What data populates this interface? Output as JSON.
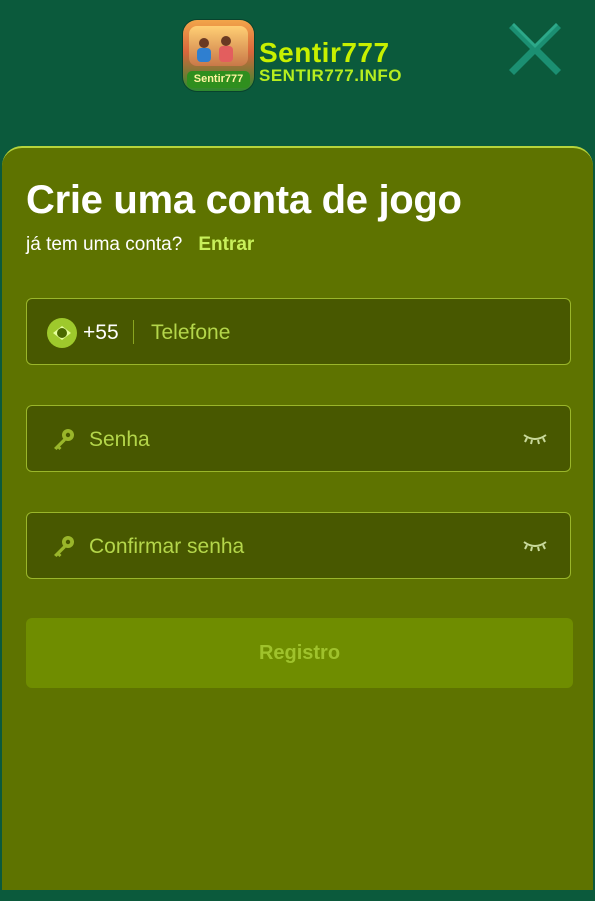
{
  "header": {
    "brand_name": "Sentir777",
    "brand_url": "SENTIR777.INFO",
    "logo_tag": "Sentir777",
    "close_icon": "close-x-icon"
  },
  "form": {
    "title": "Crie uma conta de jogo",
    "subtitle": "já tem uma conta?",
    "login_link": "Entrar",
    "phone": {
      "country_code": "+55",
      "placeholder": "Telefone",
      "flag_icon": "brazil-flag-icon"
    },
    "password": {
      "placeholder": "Senha",
      "key_icon": "key-icon",
      "toggle_icon": "eye-closed-icon"
    },
    "confirm_password": {
      "placeholder": "Confirmar senha",
      "key_icon": "key-icon",
      "toggle_icon": "eye-closed-icon"
    },
    "submit_label": "Registro"
  },
  "colors": {
    "background": "#0b5a3c",
    "panel": "#5e7300",
    "accent": "#c8f000",
    "input_bg": "#485800"
  }
}
